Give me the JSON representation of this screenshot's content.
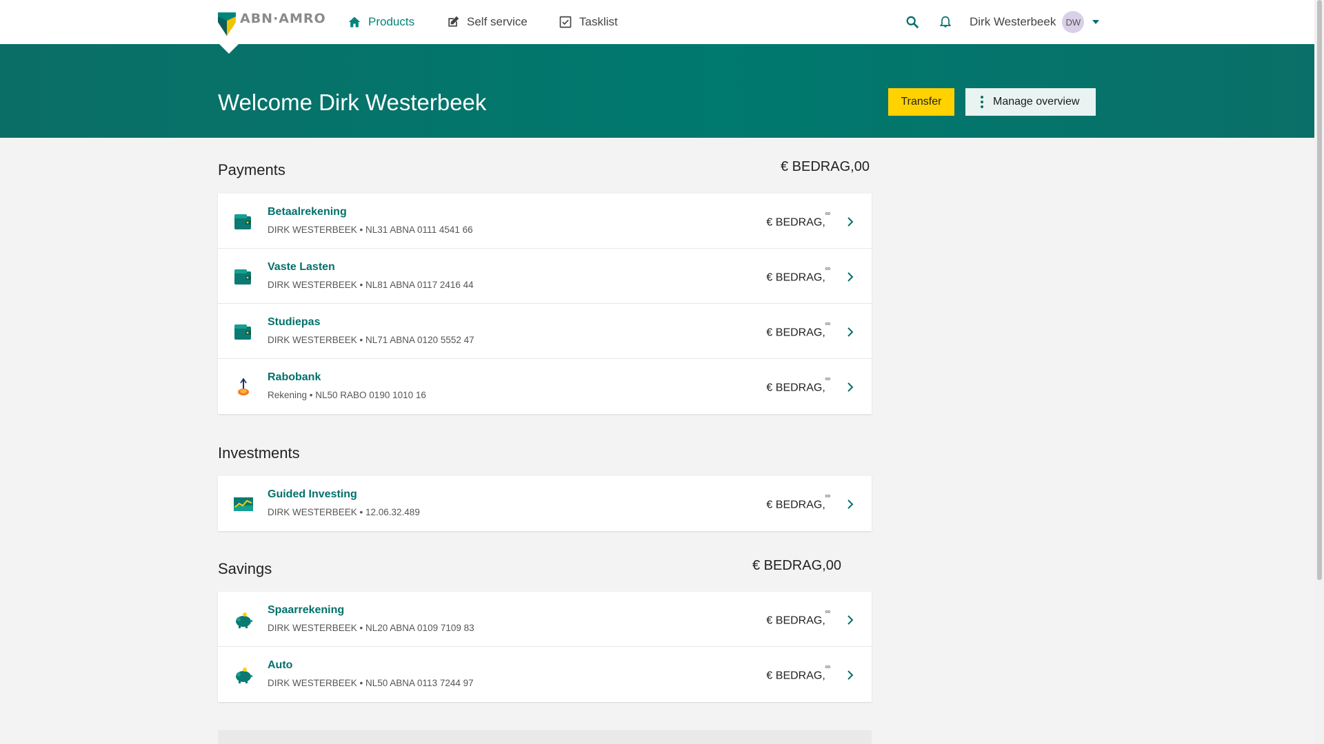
{
  "brand": {
    "name": "ABN·AMRO"
  },
  "nav": {
    "items": [
      {
        "label": "Products",
        "icon": "home-icon",
        "active": true
      },
      {
        "label": "Self service",
        "icon": "edit-icon",
        "active": false
      },
      {
        "label": "Tasklist",
        "icon": "checkbox-icon",
        "active": false
      }
    ]
  },
  "user": {
    "name": "Dirk Westerbeek",
    "initials": "DW"
  },
  "hero": {
    "welcome": "Welcome Dirk Westerbeek",
    "transfer_label": "Transfer",
    "manage_label": "Manage overview"
  },
  "sections": {
    "payments": {
      "title": "Payments",
      "total": "€ BEDRAG,00",
      "accounts": [
        {
          "name": "Betaalrekening",
          "holder": "DIRK WESTERBEEK • NL31 ABNA 0111 4541 66",
          "amount": "€ BEDRAG,",
          "cents": "⁰⁰",
          "icon": "wallet-icon"
        },
        {
          "name": "Vaste Lasten",
          "holder": "DIRK WESTERBEEK • NL81 ABNA 0117 2416 44",
          "amount": "€ BEDRAG,",
          "cents": "⁰⁰",
          "icon": "wallet-icon"
        },
        {
          "name": "Studiepas",
          "holder": "DIRK WESTERBEEK • NL71 ABNA 0120 5552 47",
          "amount": "€ BEDRAG,",
          "cents": "⁰⁰",
          "icon": "wallet-icon"
        },
        {
          "name": "Rabobank",
          "holder": "Rekening • NL50 RABO 0190 1010 16",
          "amount": "€ BEDRAG,",
          "cents": "⁰⁰",
          "icon": "rabobank-logo-icon"
        }
      ]
    },
    "investments": {
      "title": "Investments",
      "accounts": [
        {
          "name": "Guided Investing",
          "holder": "DIRK WESTERBEEK • 12.06.32.489",
          "amount": "€ BEDRAG,",
          "cents": "⁰⁰",
          "icon": "chart-line-icon"
        }
      ]
    },
    "savings": {
      "title": "Savings",
      "total": "€ BEDRAG,00",
      "accounts": [
        {
          "name": "Spaarrekening",
          "holder": "DIRK WESTERBEEK • NL20 ABNA 0109 7109 83",
          "amount": "€ BEDRAG,",
          "cents": "⁰⁰",
          "icon": "piggy-bank-icon"
        },
        {
          "name": "Auto",
          "holder": "DIRK WESTERBEEK • NL50 ABNA 0113 7244 97",
          "amount": "€ BEDRAG,",
          "cents": "⁰⁰",
          "icon": "piggy-bank-icon"
        }
      ]
    }
  },
  "colors": {
    "accent": "#00716b",
    "hero": "#00796e",
    "transfer": "#ffd200"
  }
}
